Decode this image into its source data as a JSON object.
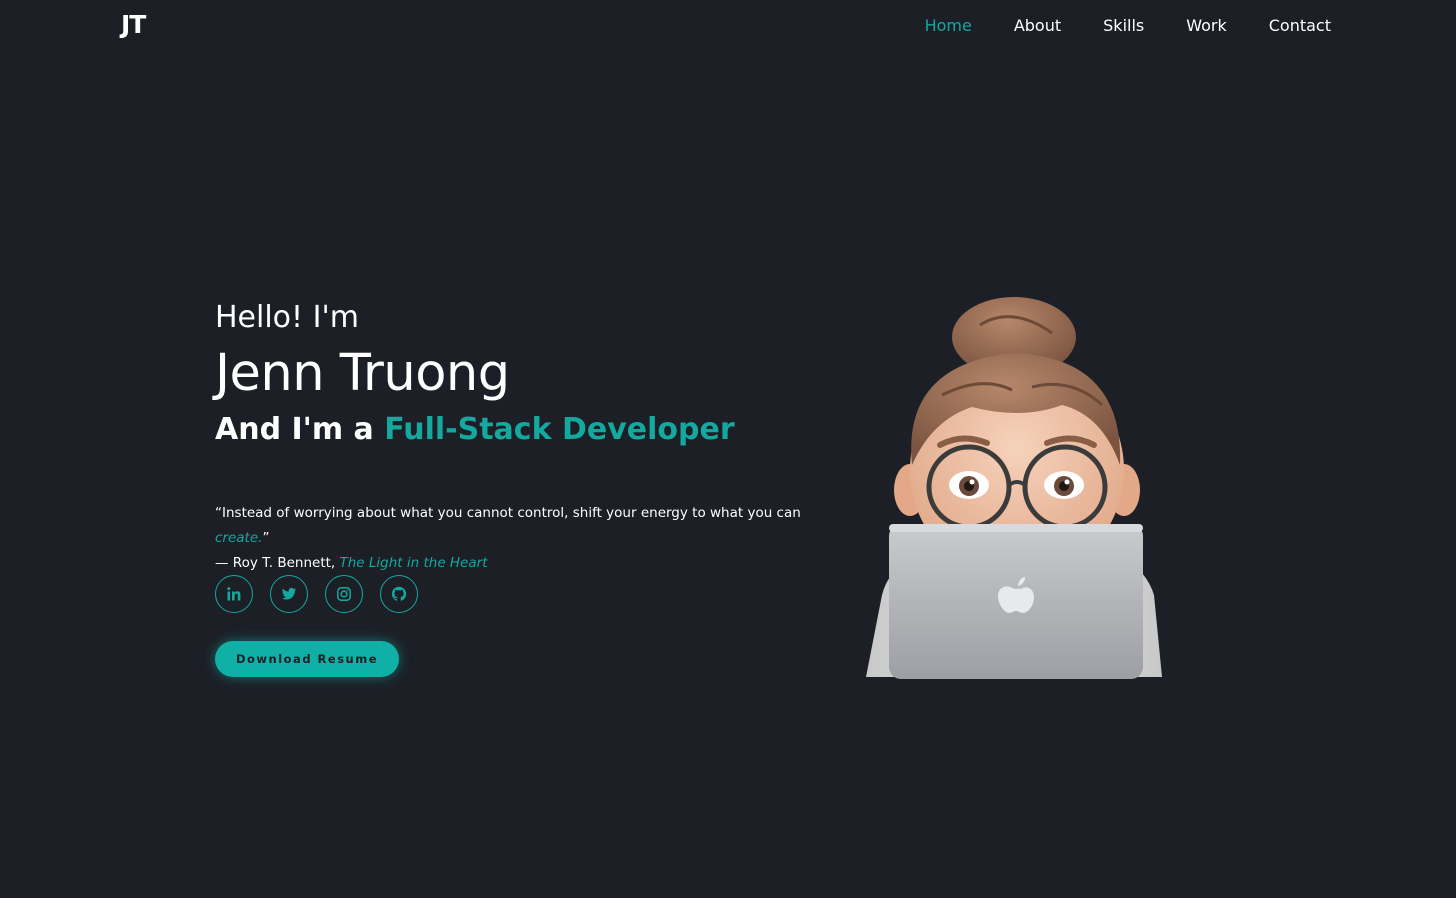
{
  "nav": {
    "logo": "JT",
    "links": [
      {
        "label": "Home",
        "active": true
      },
      {
        "label": "About",
        "active": false
      },
      {
        "label": "Skills",
        "active": false
      },
      {
        "label": "Work",
        "active": false
      },
      {
        "label": "Contact",
        "active": false
      }
    ]
  },
  "hero": {
    "greeting": "Hello! I'm",
    "name": "Jenn Truong",
    "role_prefix": "And I'm a ",
    "role_highlight": "Full-Stack Developer",
    "quote_open": "“Instead of worrying about what you cannot control, shift your energy to what you can ",
    "quote_emphasis": "create.",
    "quote_close": "”",
    "attribution_prefix": "— Roy T. Bennett, ",
    "attribution_book": "The Light in the Heart"
  },
  "socials": [
    {
      "icon": "linkedin-icon"
    },
    {
      "icon": "twitter-icon"
    },
    {
      "icon": "instagram-icon"
    },
    {
      "icon": "github-icon"
    }
  ],
  "resume_button": "Download Resume",
  "colors": {
    "background": "#1c1f26",
    "accent": "#14a89f",
    "text": "#ffffff"
  }
}
